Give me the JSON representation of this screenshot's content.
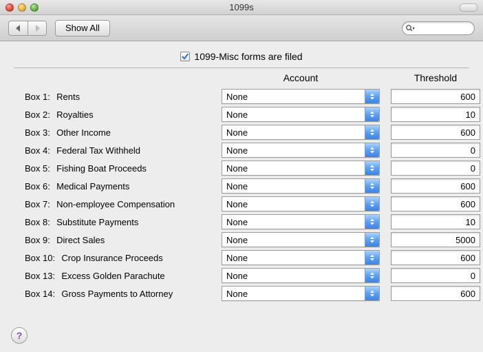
{
  "window": {
    "title": "1099s"
  },
  "toolbar": {
    "show_all_label": "Show All",
    "search_value": ""
  },
  "headline": {
    "checkbox_checked": true,
    "label": "1099-Misc forms are filed"
  },
  "columns": {
    "account": "Account",
    "threshold": "Threshold"
  },
  "box_word": "Box",
  "rows": [
    {
      "num": "1",
      "label": "Rents",
      "account": "None",
      "threshold": "600"
    },
    {
      "num": "2",
      "label": "Royalties",
      "account": "None",
      "threshold": "10"
    },
    {
      "num": "3",
      "label": "Other Income",
      "account": "None",
      "threshold": "600"
    },
    {
      "num": "4",
      "label": "Federal Tax Withheld",
      "account": "None",
      "threshold": "0"
    },
    {
      "num": "5",
      "label": "Fishing Boat Proceeds",
      "account": "None",
      "threshold": "0"
    },
    {
      "num": "6",
      "label": "Medical Payments",
      "account": "None",
      "threshold": "600"
    },
    {
      "num": "7",
      "label": "Non-employee Compensation",
      "account": "None",
      "threshold": "600"
    },
    {
      "num": "8",
      "label": "Substitute Payments",
      "account": "None",
      "threshold": "10"
    },
    {
      "num": "9",
      "label": "Direct Sales",
      "account": "None",
      "threshold": "5000"
    },
    {
      "num": "10",
      "label": "Crop Insurance Proceeds",
      "account": "None",
      "threshold": "600"
    },
    {
      "num": "13",
      "label": "Excess Golden Parachute",
      "account": "None",
      "threshold": "0"
    },
    {
      "num": "14",
      "label": "Gross Payments to Attorney",
      "account": "None",
      "threshold": "600"
    }
  ],
  "help_glyph": "?"
}
